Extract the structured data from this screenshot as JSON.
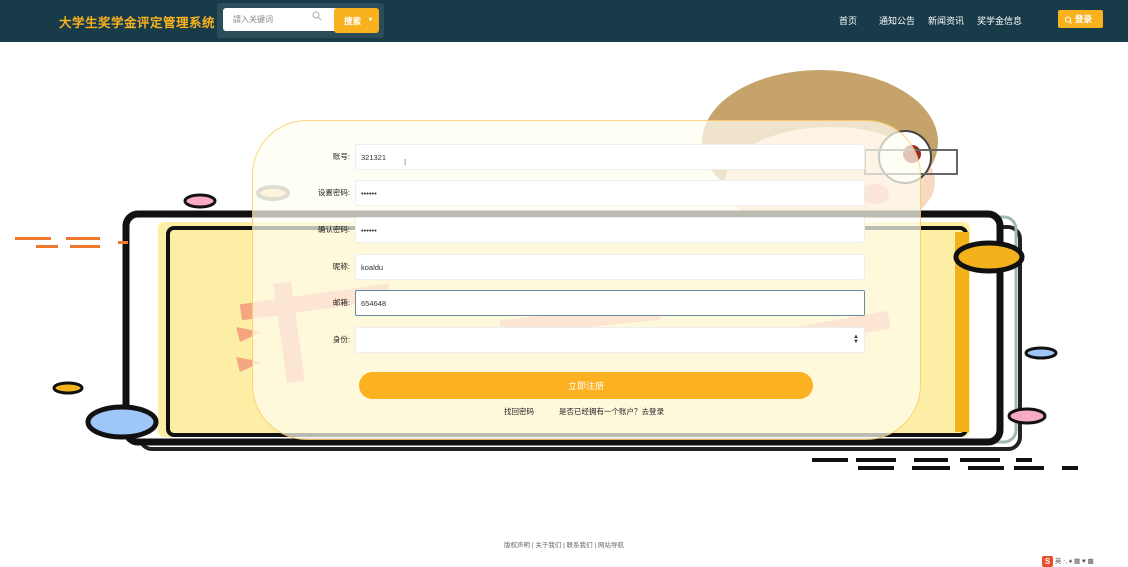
{
  "header": {
    "brand": "大学生奖学金评定管理系统",
    "search": {
      "placeholder": "請入关键词",
      "button_label": "搜索"
    },
    "nav": [
      "首页",
      "通知公告",
      "新闻资讯",
      "奖学金信息"
    ],
    "login_label": "登录"
  },
  "form": {
    "fields": [
      {
        "label": "账号:",
        "value": "321321"
      },
      {
        "label": "设置密码:",
        "value": "••••••"
      },
      {
        "label": "确认密码:",
        "value": "••••••"
      },
      {
        "label": "昵称:",
        "value": "koaldu"
      },
      {
        "label": "邮箱:",
        "value": "654648"
      },
      {
        "label": "身份:",
        "value": ""
      }
    ],
    "submit_label": "立即注册",
    "forgot_password": "找回密码",
    "have_account": "是否已经拥有一个账户？去登录"
  },
  "footer": {
    "links": [
      "版权声明",
      "关于我们",
      "联系我们",
      "网站导航"
    ],
    "separator": " | "
  },
  "ime": {
    "label": "英"
  },
  "colors": {
    "header_bg": "#173b49",
    "accent": "#f9b21e",
    "card_bg": "#fffdf1"
  }
}
